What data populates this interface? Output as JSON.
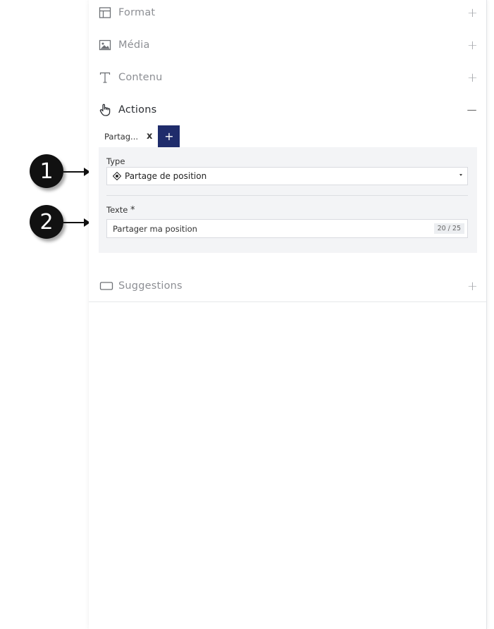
{
  "sections": {
    "format": {
      "label": "Format",
      "toggle": "+",
      "icon": "layout-icon"
    },
    "media": {
      "label": "Média",
      "toggle": "+",
      "icon": "image-icon"
    },
    "content": {
      "label": "Contenu",
      "toggle": "+",
      "icon": "text-icon"
    },
    "actions": {
      "label": "Actions",
      "toggle": "−",
      "icon": "pointer-hand-icon"
    },
    "suggestions": {
      "label": "Suggestions",
      "toggle": "+",
      "icon": "suggestion-box-icon"
    }
  },
  "action_tabs": [
    {
      "label": "Partag...",
      "close": "x"
    }
  ],
  "add_tab_label": "+",
  "form": {
    "type_label": "Type",
    "type_value": "Partage de position",
    "type_icon": "location-crosshair-icon",
    "text_label": "Texte",
    "required_mark": "*",
    "text_value": "Partager ma position",
    "text_counter": "20 / 25"
  },
  "callouts": [
    "1",
    "2"
  ],
  "colors": {
    "accent": "#1f2c6b",
    "form_background": "#f3f4f6",
    "muted_text": "#8d8f94"
  }
}
